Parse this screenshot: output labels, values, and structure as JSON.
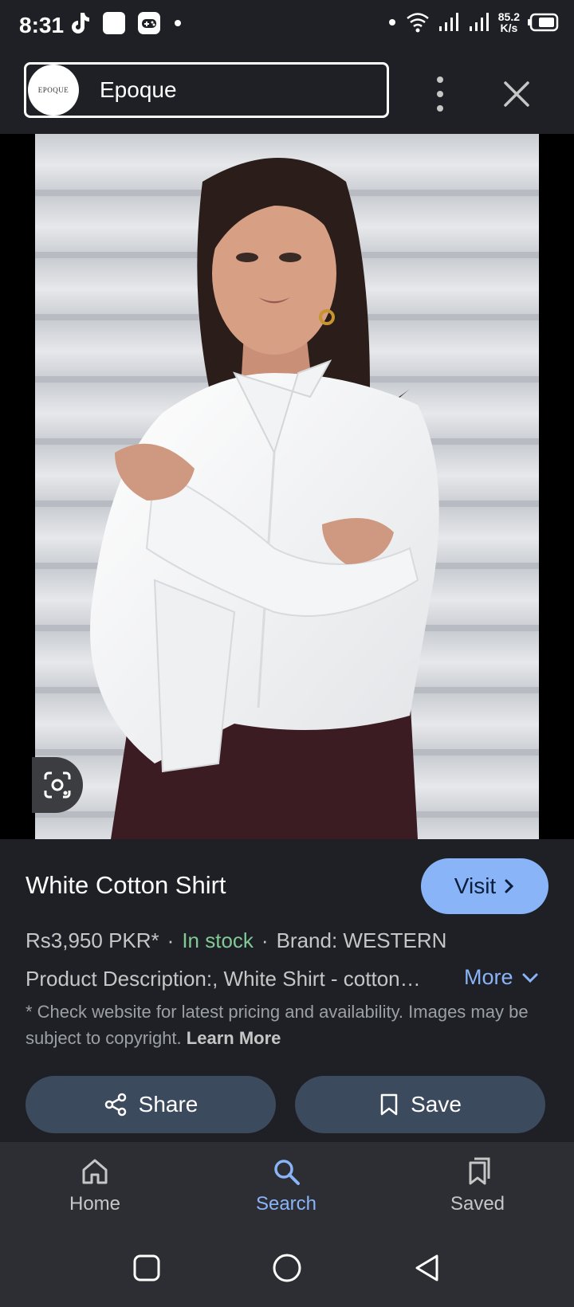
{
  "status_bar": {
    "time": "8:31",
    "speed_value": "85.2",
    "speed_unit": "K/s",
    "left_icons": [
      "tiktok-icon",
      "app-square-icon",
      "gamepad-icon",
      "dot-icon"
    ],
    "right_icons": [
      "dot-icon",
      "wifi-icon",
      "signal-icon",
      "signal-icon",
      "battery-icon"
    ]
  },
  "header": {
    "logo_text": "EPOQUE",
    "source_name": "Epoque",
    "icons": [
      "more-vert-icon",
      "close-icon"
    ]
  },
  "product": {
    "title": "White Cotton Shirt",
    "visit_label": "Visit",
    "price": "Rs3,950 PKR*",
    "separator": "·",
    "stock": "In stock",
    "brand": "Brand: WESTERN",
    "description": "Product Description:, White Shirt - cotton…",
    "more_label": "More",
    "disclaimer": "* Check website for latest pricing and availability. Images may be subject to copyright.",
    "learn_more": "Learn More",
    "share_label": "Share",
    "save_label": "Save"
  },
  "bottom_nav": {
    "items": [
      {
        "label": "Home",
        "icon": "home-icon"
      },
      {
        "label": "Search",
        "icon": "search-icon",
        "active": true
      },
      {
        "label": "Saved",
        "icon": "bookmarks-icon"
      }
    ]
  },
  "colors": {
    "accent": "#8ab4f8",
    "in_stock": "#81c995",
    "background": "#1f2025",
    "button_bg": "#3c4a5e"
  }
}
